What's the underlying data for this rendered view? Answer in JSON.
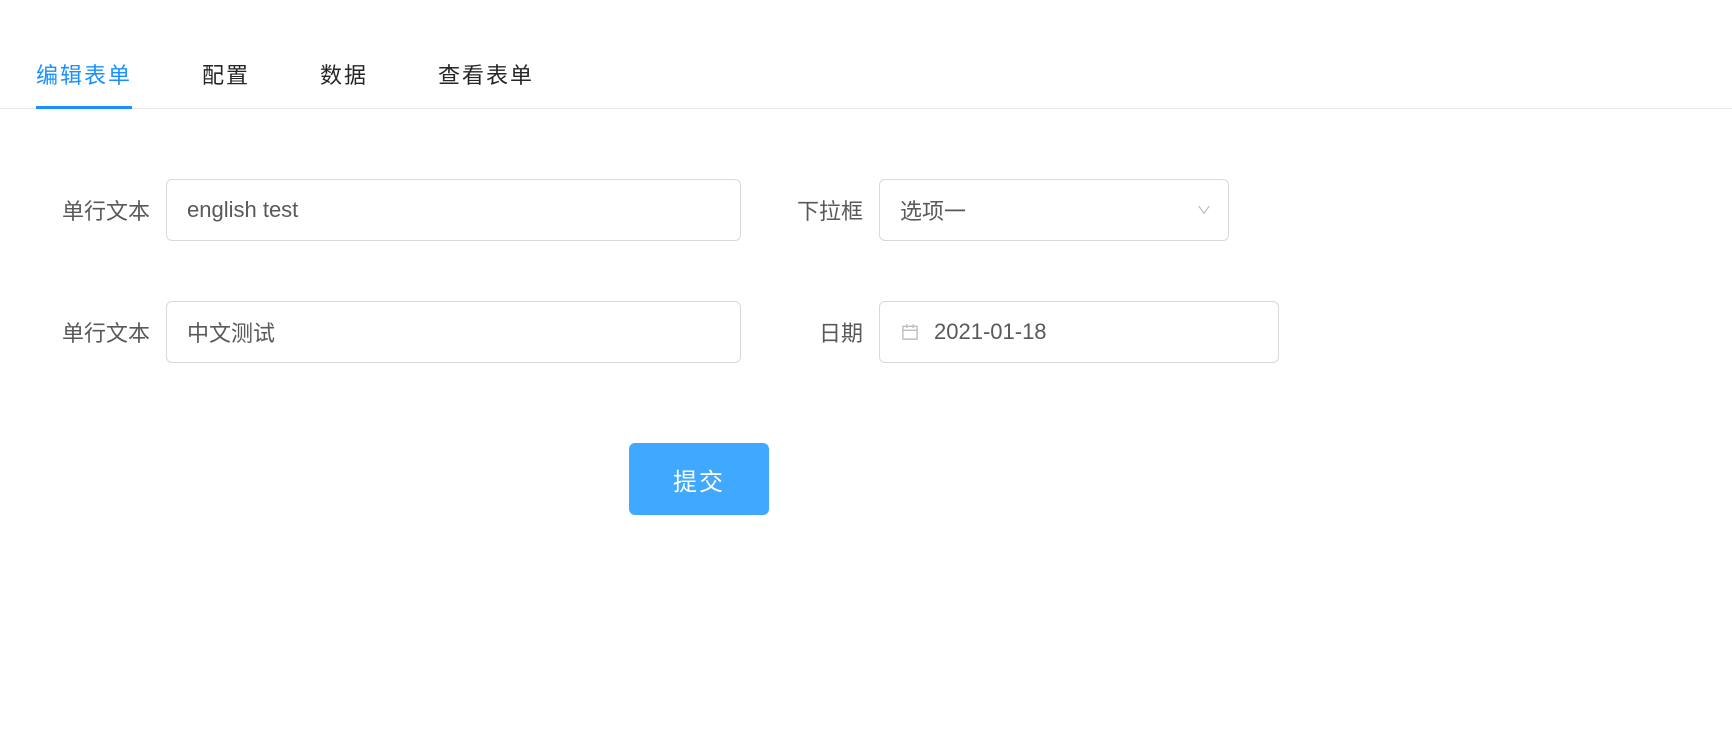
{
  "tabs": [
    {
      "label": "编辑表单",
      "active": true
    },
    {
      "label": "配置",
      "active": false
    },
    {
      "label": "数据",
      "active": false
    },
    {
      "label": "查看表单",
      "active": false
    }
  ],
  "form": {
    "text1_label": "单行文本",
    "text1_value": "english test",
    "select_label": "下拉框",
    "select_value": "选项一",
    "text2_label": "单行文本",
    "text2_value": "中文测试",
    "date_label": "日期",
    "date_value": "2021-01-18",
    "submit_label": "提交"
  }
}
